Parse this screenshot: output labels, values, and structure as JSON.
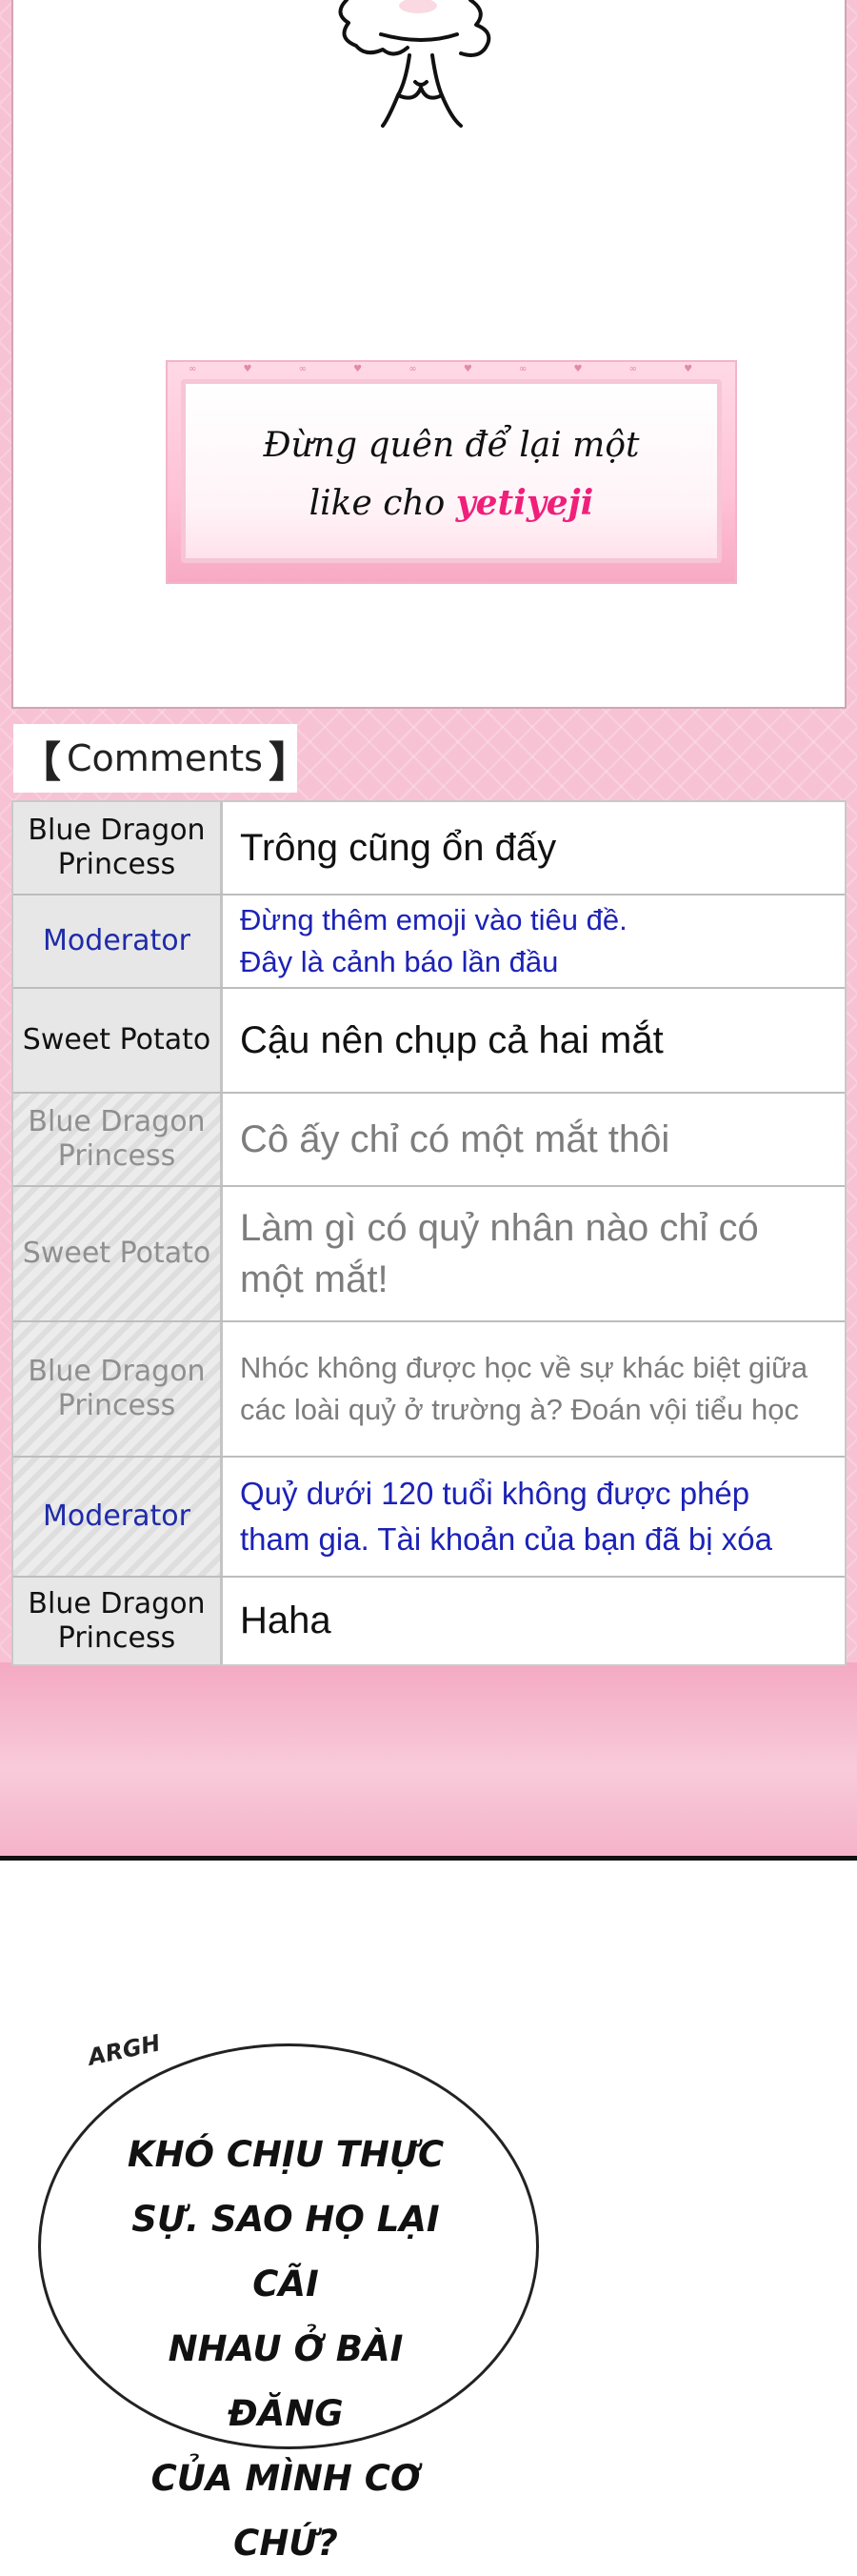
{
  "banner": {
    "line1": "Đừng quên để lại một",
    "line2_prefix": "like cho ",
    "line2_brand": "yetiyeji",
    "dots": "∞ ♥ ∞ ♥ ∞ ♥ ∞ ♥ ∞ ♥ ∞ ♥ ∞ ♥ ∞ ♥"
  },
  "comments": {
    "header": "Comments",
    "bracket_open": "【",
    "bracket_close": "】",
    "rows": [
      {
        "user": "Blue Dragon Princess",
        "lines": [
          "Trông cũng ổn đấy"
        ]
      },
      {
        "user": "Moderator",
        "lines": [
          "Đừng thêm emoji vào tiêu đề.",
          "Đây là cảnh báo lần đầu"
        ]
      },
      {
        "user": "Sweet Potato",
        "lines": [
          "Cậu nên chụp cả hai mắt"
        ]
      },
      {
        "user": "Blue Dragon Princess",
        "lines": [
          "Cô ấy chỉ có một mắt thôi"
        ]
      },
      {
        "user": "Sweet Potato",
        "lines": [
          "Làm gì có quỷ nhân nào chỉ có",
          "một mắt!"
        ]
      },
      {
        "user": "Blue Dragon Princess",
        "lines": [
          "Nhóc không được học về sự khác biệt giữa",
          "các loài quỷ ở trường à? Đoán vội tiểu học"
        ]
      },
      {
        "user": "Moderator",
        "lines": [
          "Quỷ dưới 120 tuổi không được phép",
          "tham gia. Tài khoản của bạn đã bị xóa"
        ]
      },
      {
        "user": "Blue Dragon Princess",
        "lines": [
          "Haha"
        ]
      }
    ]
  },
  "bubble": {
    "sfx": "ARGH",
    "lines": [
      "KHÓ CHỊU THỰC",
      "SỰ. SAO HỌ LẠI CÃI",
      "NHAU Ở BÀI ĐĂNG",
      "CỦA MÌNH CƠ CHỨ?"
    ]
  },
  "colors": {
    "pink_bg": "#f7c3d4",
    "moderator_blue": "#1f2ba8",
    "brand_magenta": "#f01f7a",
    "faded_grey": "#8f8f8f"
  }
}
